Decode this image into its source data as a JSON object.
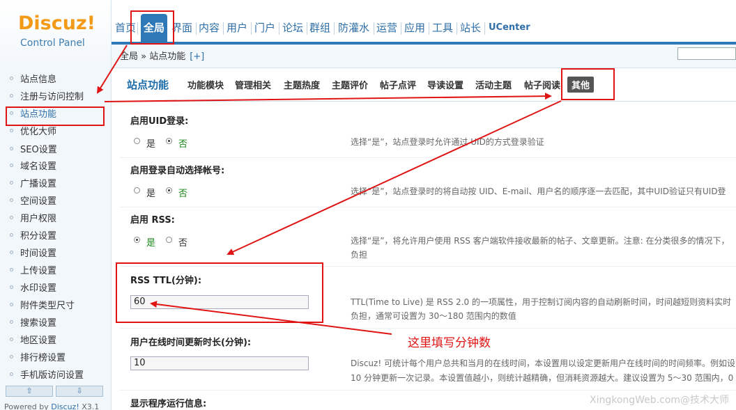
{
  "logo": {
    "brand": "Discuz!",
    "subtitle": "Control Panel"
  },
  "topnav": {
    "items": [
      "首页",
      "全局",
      "界面",
      "内容",
      "用户",
      "门户",
      "论坛",
      "群组",
      "防灌水",
      "运营",
      "应用",
      "工具",
      "站长",
      "UCenter"
    ],
    "active_index": 1
  },
  "breadcrumb": {
    "path": "全局 » 站点功能",
    "add": "[+]"
  },
  "sidebar": {
    "items": [
      "站点信息",
      "注册与访问控制",
      "站点功能",
      "优化大师",
      "SEO设置",
      "域名设置",
      "广播设置",
      "空间设置",
      "用户权限",
      "积分设置",
      "时间设置",
      "上传设置",
      "水印设置",
      "附件类型尺寸",
      "搜索设置",
      "地区设置",
      "排行榜设置",
      "手机版访问设置"
    ],
    "active_index": 2,
    "scroll_up": "⇧",
    "scroll_down": "⇩",
    "powered_prefix": "Powered by ",
    "powered_link": "Discuz!",
    "powered_version": " X3.1"
  },
  "subtabs": {
    "title": "站点功能",
    "tabs": [
      "功能模块",
      "管理相关",
      "主题热度",
      "主题评价",
      "帖子点评",
      "导读设置",
      "活动主题",
      "帖子阅读",
      "其他"
    ],
    "current_index": 8
  },
  "form": {
    "uid_login": {
      "label": "启用UID登录:",
      "options": [
        "是",
        "否"
      ],
      "selected": "否",
      "desc": "选择“是”，站点登录时允许通过 UID的方式登录验证"
    },
    "auto_account": {
      "label": "启用登录自动选择帐号:",
      "options": [
        "是",
        "否"
      ],
      "selected": "否",
      "desc": "选择“是”，站点登录时的将自动按 UID、E-mail、用户名的顺序逐一去匹配，其中UID验证只有UID登"
    },
    "rss": {
      "label": "启用 RSS:",
      "options": [
        "是",
        "否"
      ],
      "selected": "是",
      "desc_line1": "选择“是”，将允许用户使用 RSS 客户端软件接收最新的帖子、文章更新。注意: 在分类很多的情况下，",
      "desc_line2": "负担"
    },
    "rss_ttl": {
      "label": "RSS TTL(分钟):",
      "value": "60",
      "desc_line1": "TTL(Time to Live) 是 RSS 2.0 的一项属性，用于控制订阅内容的自动刷新时间，时间越短则资料实时",
      "desc_line2": "负担，通常可设置为 30～180 范围内的数值"
    },
    "online_update": {
      "label": "用户在线时间更新时长(分钟):",
      "value": "10",
      "desc_line1": "Discuz! 可统计每个用户总共和当月的在线时间，本设置用以设定更新用户在线时间的时间频率。例如设",
      "desc_line2": "10 分钟更新一次记录。本设置值越小，则统计越精确，但消耗资源越大。建议设置为 5～30 范围内，0"
    },
    "show_runtime": {
      "label": "显示程序运行信息:"
    }
  },
  "annotation": {
    "text": "这里填写分钟数",
    "color": "#e01414"
  },
  "watermark": "XingkongWeb.com@技术大师"
}
